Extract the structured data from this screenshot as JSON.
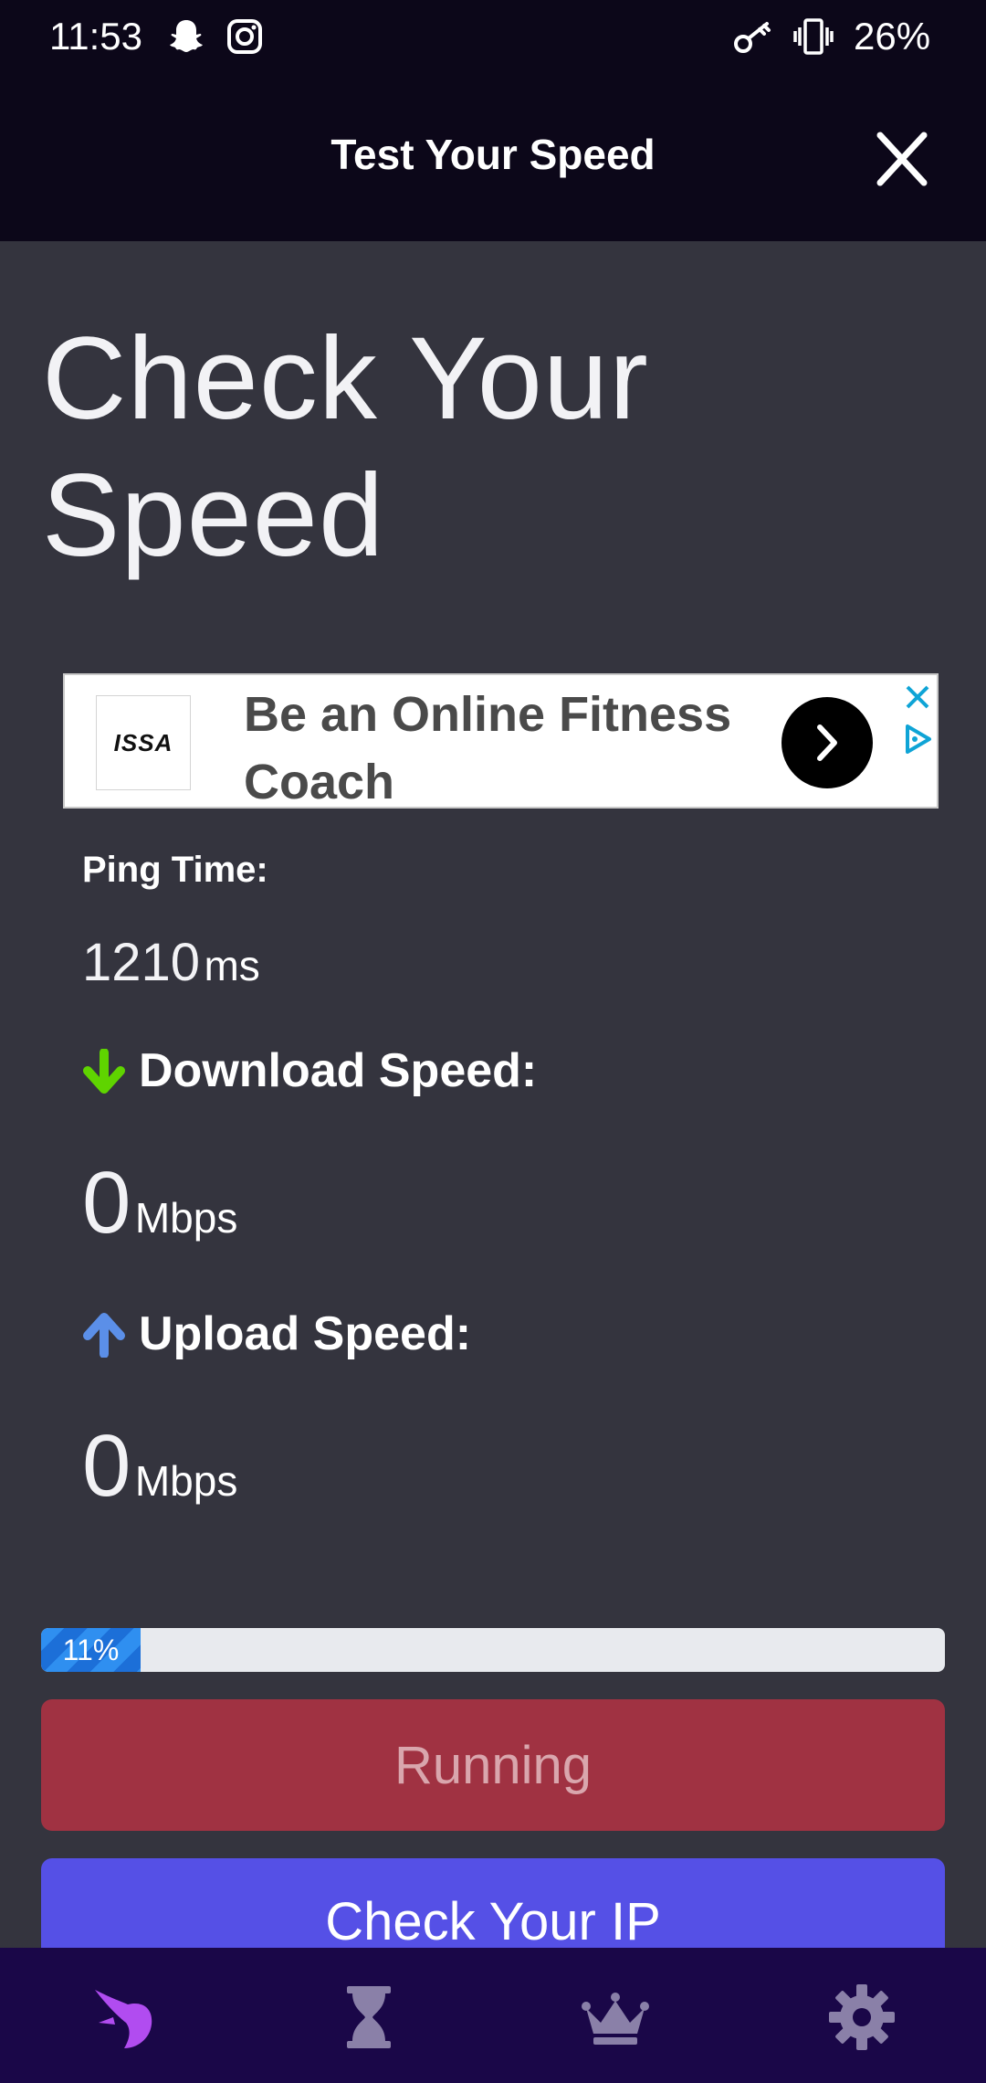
{
  "status_bar": {
    "time": "11:53",
    "battery": "26%",
    "icons": [
      "snapchat-icon",
      "instagram-icon",
      "vpn-key-icon",
      "vibrate-icon"
    ]
  },
  "header": {
    "title": "Test Your Speed",
    "close_icon": "close-icon"
  },
  "hero": {
    "title": "Check Your Speed"
  },
  "ad": {
    "logo_text": "ISSA",
    "headline": "Be an Online Fitness Coach",
    "icons": [
      "chevron-right-icon",
      "ad-close-icon",
      "adchoices-icon"
    ]
  },
  "ping": {
    "label": "Ping Time:",
    "value": "1210",
    "unit": "ms"
  },
  "download": {
    "label": "Download Speed:",
    "value": "0",
    "unit": "Mbps",
    "icon": "arrow-down-icon",
    "icon_color": "#5fd400"
  },
  "upload": {
    "label": "Upload Speed:",
    "value": "0",
    "unit": "Mbps",
    "icon": "arrow-up-icon",
    "icon_color": "#5b8fe8"
  },
  "progress": {
    "label": "11%",
    "fraction": 0.11
  },
  "buttons": {
    "running": "Running",
    "check_ip": "Check Your IP"
  },
  "bottom_nav": {
    "items": [
      "speed-test-icon",
      "history-icon",
      "premium-crown-icon",
      "settings-icon"
    ],
    "active_color": "#b14cf0",
    "inactive_color": "#8a80a8"
  },
  "colors": {
    "background": "#34343e",
    "topbar": "#0c0719",
    "running_button": "#a03242",
    "ip_button": "#5550e6",
    "nav": "#1a0748"
  }
}
